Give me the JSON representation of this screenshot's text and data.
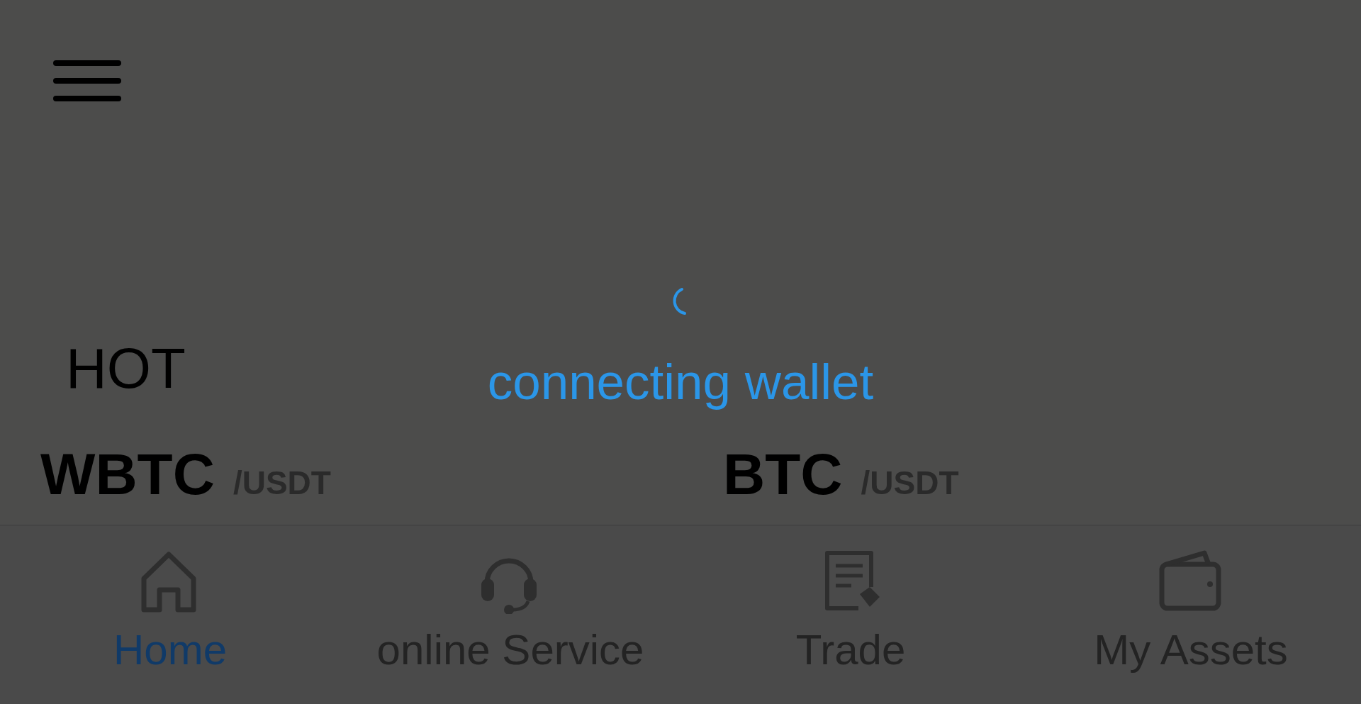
{
  "loading": {
    "message": "connecting wallet"
  },
  "hot": {
    "title": "HOT",
    "pairs": [
      {
        "base": "WBTC",
        "quote": "/USDT"
      },
      {
        "base": "BTC",
        "quote": "/USDT"
      }
    ]
  },
  "tabs": [
    {
      "label": "Home",
      "kind": "home",
      "selected": true
    },
    {
      "label": "online Service",
      "kind": "headset",
      "selected": false
    },
    {
      "label": "Trade",
      "kind": "document",
      "selected": false
    },
    {
      "label": "My Assets",
      "kind": "wallet",
      "selected": false
    }
  ]
}
